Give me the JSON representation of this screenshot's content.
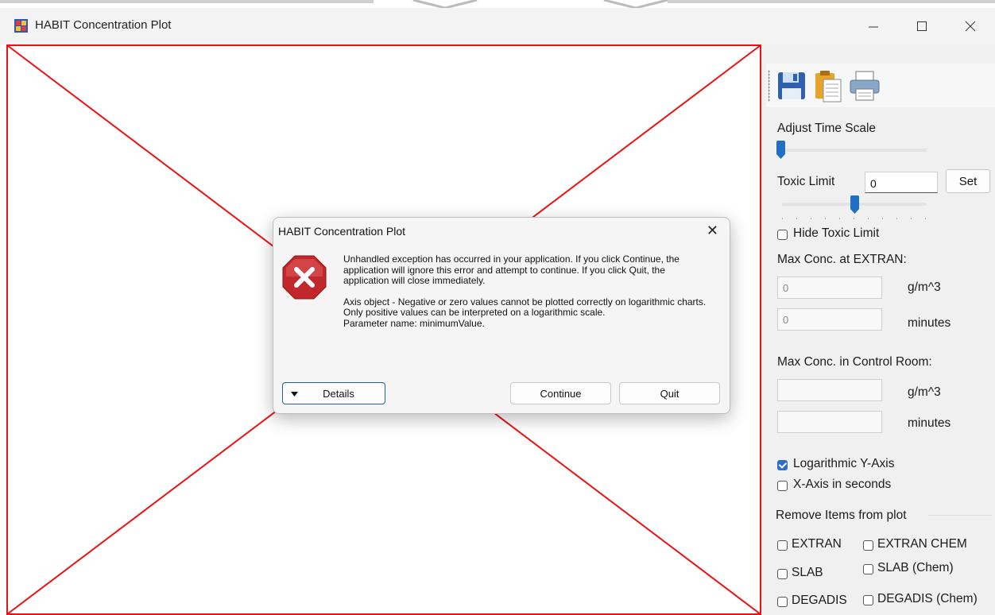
{
  "window": {
    "title": "HABIT Concentration Plot",
    "controls": {
      "minimize": "—",
      "maximize": "☐",
      "close": "✕"
    }
  },
  "toolbar": {
    "icons": [
      "save-icon",
      "clipboard-icon",
      "printer-icon"
    ]
  },
  "panel": {
    "adjust_time_scale": "Adjust Time Scale",
    "toxic_limit_label": "Toxic Limit",
    "toxic_limit_value": "0",
    "set_button": "Set",
    "hide_toxic_limit": "Hide Toxic Limit",
    "hide_toxic_limit_checked": false,
    "max_conc_extran": "Max Conc. at EXTRAN:",
    "extran_conc_value": "0",
    "extran_conc_unit": "g/m^3",
    "extran_time_value": "0",
    "extran_time_unit": "minutes",
    "max_conc_control_room": "Max Conc. in Control Room:",
    "cr_conc_value": "",
    "cr_conc_unit": "g/m^3",
    "cr_time_value": "",
    "cr_time_unit": "minutes",
    "log_y_axis": "Logarithmic Y-Axis",
    "log_y_axis_checked": true,
    "x_axis_seconds": "X-Axis in seconds",
    "x_axis_seconds_checked": false,
    "remove_items": "Remove Items from plot",
    "items": {
      "extran": "EXTRAN",
      "extran_chem": "EXTRAN CHEM",
      "slab": "SLAB",
      "slab_chem": "SLAB (Chem)",
      "degadis": "DEGADIS",
      "degadis_chem": "DEGADIS (Chem)"
    }
  },
  "dialog": {
    "title": "HABIT Concentration Plot",
    "close": "✕",
    "message_1": "Unhandled exception has occurred in your application. If you click Continue, the application will ignore this error and attempt to continue. If you click Quit, the application will close immediately.",
    "message_2": "Axis object - Negative or zero values cannot be plotted correctly on logarithmic charts. Only positive values can be interpreted on a logarithmic scale.",
    "message_3": "Parameter name: minimumValue.",
    "details_button": "Details",
    "continue_button": "Continue",
    "quit_button": "Quit"
  },
  "colors": {
    "plot_error_red": "#ee1111",
    "checkbox_blue": "#2f6dc9",
    "error_icon_red": "#c0282c"
  }
}
